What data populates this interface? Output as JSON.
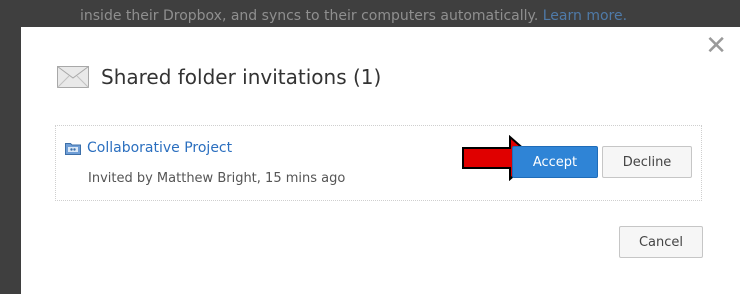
{
  "backdrop": {
    "text": "inside their Dropbox, and syncs to their computers automatically.",
    "link": "Learn more."
  },
  "dialog": {
    "close_glyph": "✕",
    "title": "Shared folder invitations (1)",
    "title_icon": "envelope-icon",
    "invitation": {
      "folder_icon": "shared-folder-icon",
      "folder_name": "Collaborative Project",
      "invited_by": "Invited by Matthew Bright, 15 mins ago",
      "accept_label": "Accept",
      "decline_label": "Decline",
      "annotation_icon": "red-arrow-icon"
    },
    "cancel_label": "Cancel"
  },
  "colors": {
    "accept_button": "#2f84d6",
    "link": "#2b6fbf",
    "annotation_arrow": "#e00000",
    "overlay": "#3f3f3f"
  }
}
